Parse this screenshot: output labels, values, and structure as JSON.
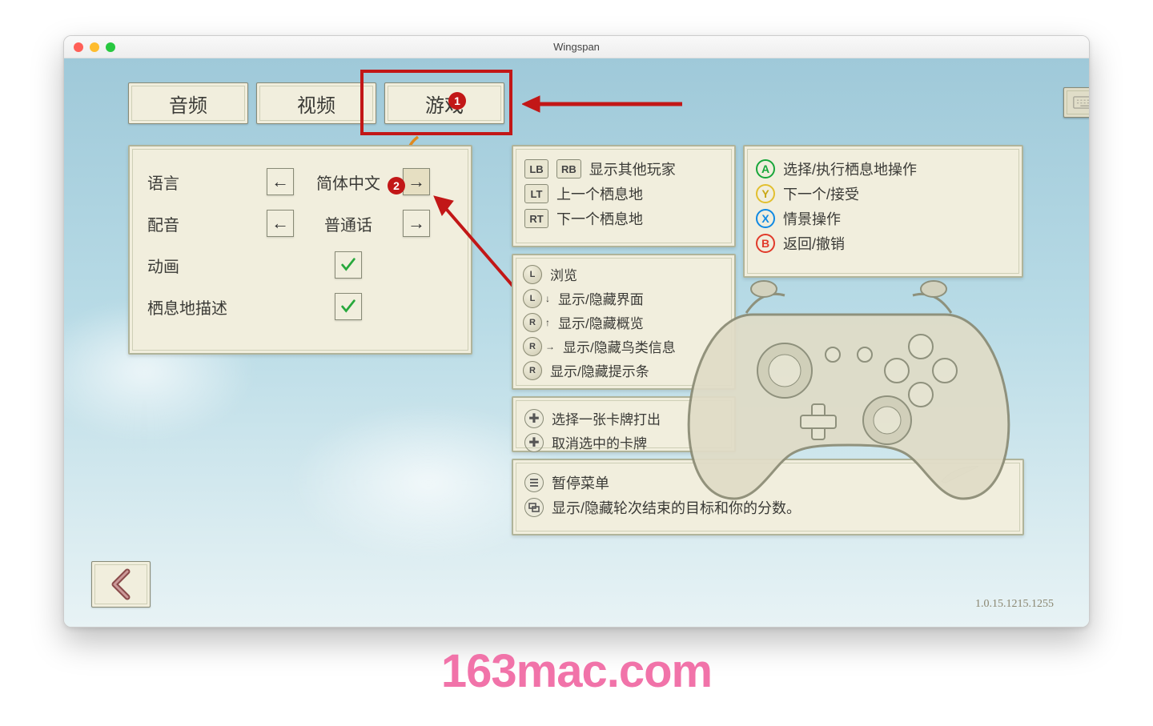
{
  "window": {
    "title": "Wingspan"
  },
  "tabs": {
    "audio": "音频",
    "video": "视频",
    "game": "游戏"
  },
  "settings": {
    "language_label": "语言",
    "language_value": "简体中文",
    "voice_label": "配音",
    "voice_value": "普通话",
    "animation_label": "动画",
    "habitat_label": "栖息地描述"
  },
  "controls_a": {
    "lb": "LB",
    "rb": "RB",
    "lbrb_text": "显示其他玩家",
    "lt": "LT",
    "lt_text": "上一个栖息地",
    "rt": "RT",
    "rt_text": "下一个栖息地"
  },
  "controls_b": {
    "a": "A",
    "a_text": "选择/执行栖息地操作",
    "a_color": "#18a63a",
    "y": "Y",
    "y_text": "下一个/接受",
    "y_color": "#e2bf2e",
    "x": "X",
    "x_text": "情景操作",
    "x_color": "#0f89e3",
    "b": "B",
    "b_text": "返回/撤销",
    "b_color": "#e13a2a"
  },
  "controls_c": {
    "l1": "L",
    "l1_text": "浏览",
    "l2": "L",
    "l2_text": "显示/隐藏界面",
    "r1": "R",
    "r1_text": "显示/隐藏概览",
    "r2": "R",
    "r2_text": "显示/隐藏鸟类信息",
    "r3": "R",
    "r3_text": "显示/隐藏提示条"
  },
  "controls_d": {
    "d1_text": "选择一张卡牌打出",
    "d2_text": "取消选中的卡牌"
  },
  "controls_e": {
    "e1_text": "暂停菜单",
    "e2_text": "显示/隐藏轮次结束的目标和你的分数"
  },
  "period": "。",
  "annotations": {
    "badge1": "1",
    "badge2": "2"
  },
  "version": "1.0.15.1215.1255",
  "watermark": "163mac.com"
}
